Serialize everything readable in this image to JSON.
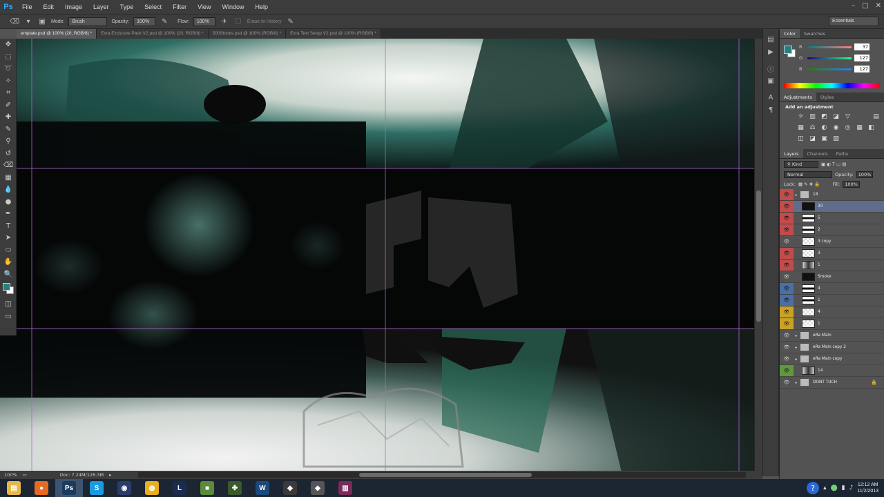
{
  "app": {
    "logo": "Ps"
  },
  "menu": [
    "File",
    "Edit",
    "Image",
    "Layer",
    "Type",
    "Select",
    "Filter",
    "View",
    "Window",
    "Help"
  ],
  "window_controls": {
    "minimize": "–",
    "maximize": "□",
    "close": "✕"
  },
  "options_bar": {
    "mode_label": "Mode:",
    "mode_value": "Brush",
    "opacity_label": "Opacity:",
    "opacity_value": "100%",
    "flow_label": "Flow:",
    "flow_value": "100%",
    "erase_history_label": "Erase to History",
    "workspace": "Essentials"
  },
  "tabs": [
    {
      "label": "emplate.psd @ 100% (20, RGB/8) *",
      "active": true
    },
    {
      "label": "Exra Exclusive Pack V2.psd @ 100% (20, RGB/8) *",
      "active": false
    },
    {
      "label": "500Stocks.psd @ 100% (RGB/8) *",
      "active": false
    },
    {
      "label": "Exra Text Setup V2.psd @ 100% (RGB/8) *",
      "active": false
    }
  ],
  "status": {
    "zoom": "100%",
    "doc": "Doc: 7.24M/126.3M"
  },
  "color_panel": {
    "tabs": [
      "Color",
      "Swatches"
    ],
    "fg_color": "#257f7f",
    "r": "37",
    "g": "127",
    "b": "127"
  },
  "adjustments_panel": {
    "tabs": [
      "Adjustments",
      "Styles"
    ],
    "title": "Add an adjustment"
  },
  "layers_panel": {
    "tabs": [
      "Layers",
      "Channels",
      "Paths"
    ],
    "kind_label": "Kind",
    "blend_mode": "Normal",
    "opacity_label": "Opacity:",
    "opacity_value": "100%",
    "lock_label": "Lock:",
    "fill_label": "Fill:",
    "fill_value": "100%",
    "layers": [
      {
        "name": "18",
        "color": "#c14c4c",
        "type": "group",
        "selected": false
      },
      {
        "name": "20",
        "color": "#c14c4c",
        "type": "black",
        "selected": true
      },
      {
        "name": "5",
        "color": "#c14c4c",
        "type": "stripe",
        "selected": false
      },
      {
        "name": "2",
        "color": "#c14c4c",
        "type": "stripe",
        "selected": false
      },
      {
        "name": "3 copy",
        "color": "",
        "type": "white",
        "selected": false
      },
      {
        "name": "3",
        "color": "#c14c4c",
        "type": "white",
        "selected": false
      },
      {
        "name": "1",
        "color": "#c14c4c",
        "type": "photo",
        "selected": false
      },
      {
        "name": "Smoke",
        "color": "",
        "type": "black",
        "selected": false
      },
      {
        "name": "4",
        "color": "#4a6fa5",
        "type": "stripe",
        "selected": false
      },
      {
        "name": "1",
        "color": "#4a6fa5",
        "type": "stripe",
        "selected": false
      },
      {
        "name": "4",
        "color": "#c9a227",
        "type": "white",
        "selected": false
      },
      {
        "name": "1",
        "color": "#c9a227",
        "type": "white",
        "selected": false
      },
      {
        "name": "eRa Main",
        "color": "",
        "type": "group",
        "selected": false
      },
      {
        "name": "eRa Main copy 2",
        "color": "",
        "type": "group",
        "selected": false
      },
      {
        "name": "eRa Main copy",
        "color": "",
        "type": "group",
        "selected": false
      },
      {
        "name": "14",
        "color": "#5e9a3a",
        "type": "photo",
        "selected": false
      },
      {
        "name": "DONT TUCH",
        "color": "",
        "type": "group",
        "selected": false,
        "locked": true
      }
    ]
  },
  "taskbar": {
    "apps": [
      {
        "name": "explorer",
        "glyph": "▤",
        "color": "#e6b84a"
      },
      {
        "name": "firefox",
        "glyph": "●",
        "color": "#e66a1f"
      },
      {
        "name": "photoshop",
        "glyph": "Ps",
        "color": "#1b3a5c",
        "active": true
      },
      {
        "name": "skype",
        "glyph": "S",
        "color": "#1a9ae0"
      },
      {
        "name": "cinema4d",
        "glyph": "◉",
        "color": "#2a3d6a"
      },
      {
        "name": "browser",
        "glyph": "◍",
        "color": "#e8b020"
      },
      {
        "name": "lightroom",
        "glyph": "L",
        "color": "#1b2b4f"
      },
      {
        "name": "minecraft",
        "glyph": "■",
        "color": "#5a8a3a"
      },
      {
        "name": "tool",
        "glyph": "✤",
        "color": "#3a5a2a"
      },
      {
        "name": "app-w",
        "glyph": "W",
        "color": "#1a4a7a"
      },
      {
        "name": "app-diamond",
        "glyph": "◆",
        "color": "#3a3a3a"
      },
      {
        "name": "app-shape",
        "glyph": "◆",
        "color": "#555"
      },
      {
        "name": "winrar",
        "glyph": "▥",
        "color": "#7a2a5a"
      }
    ],
    "time": "12:12 AM",
    "date": "11/2/2013"
  }
}
